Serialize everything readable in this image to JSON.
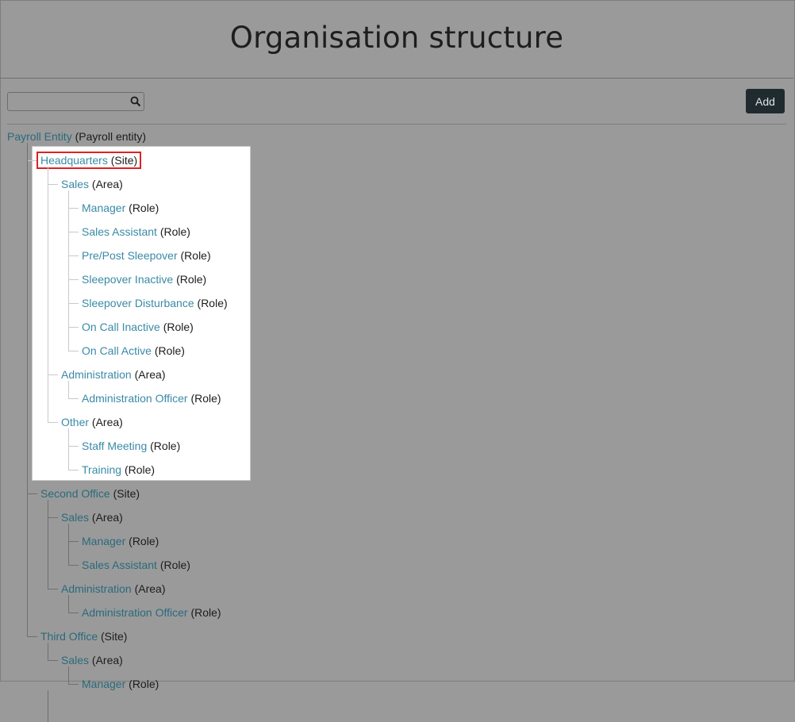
{
  "page": {
    "title": "Organisation structure"
  },
  "toolbar": {
    "search_value": "",
    "add_label": "Add"
  },
  "tree": {
    "root": {
      "label": "Payroll Entity",
      "kind": "(Payroll entity)"
    },
    "sites": [
      {
        "label": "Headquarters",
        "kind": "(Site)",
        "areas": [
          {
            "label": "Sales",
            "kind": "(Area)",
            "roles": [
              {
                "label": "Manager",
                "kind": "(Role)"
              },
              {
                "label": "Sales Assistant",
                "kind": "(Role)"
              },
              {
                "label": "Pre/Post Sleepover",
                "kind": "(Role)"
              },
              {
                "label": "Sleepover Inactive",
                "kind": "(Role)"
              },
              {
                "label": "Sleepover Disturbance",
                "kind": "(Role)"
              },
              {
                "label": "On Call Inactive",
                "kind": "(Role)"
              },
              {
                "label": "On Call Active",
                "kind": "(Role)"
              }
            ]
          },
          {
            "label": "Administration",
            "kind": "(Area)",
            "roles": [
              {
                "label": "Administration Officer",
                "kind": "(Role)"
              }
            ]
          },
          {
            "label": "Other",
            "kind": "(Area)",
            "roles": [
              {
                "label": "Staff Meeting",
                "kind": "(Role)"
              },
              {
                "label": "Training",
                "kind": "(Role)"
              }
            ]
          }
        ]
      },
      {
        "label": "Second Office",
        "kind": "(Site)",
        "areas": [
          {
            "label": "Sales",
            "kind": "(Area)",
            "roles": [
              {
                "label": "Manager",
                "kind": "(Role)"
              },
              {
                "label": "Sales Assistant",
                "kind": "(Role)"
              }
            ]
          },
          {
            "label": "Administration",
            "kind": "(Area)",
            "roles": [
              {
                "label": "Administration Officer",
                "kind": "(Role)"
              }
            ]
          }
        ]
      },
      {
        "label": "Third Office",
        "kind": "(Site)",
        "areas": [
          {
            "label": "Sales",
            "kind": "(Area)",
            "roles": [
              {
                "label": "Manager",
                "kind": "(Role)"
              }
            ]
          }
        ]
      }
    ]
  }
}
